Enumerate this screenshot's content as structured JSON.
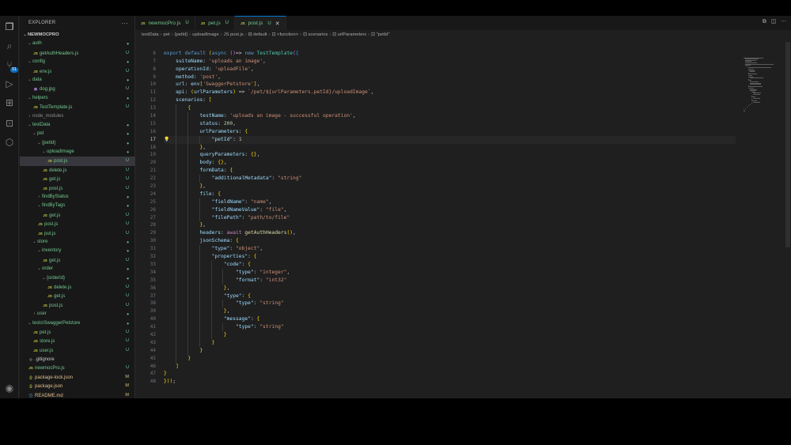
{
  "explorer": {
    "title": "EXPLORER",
    "more": "···",
    "root": "NEWMOCPRO"
  },
  "tree": [
    {
      "depth": 1,
      "kind": "folder",
      "open": true,
      "name": "auth",
      "badge": "dot",
      "tone": "u"
    },
    {
      "depth": 2,
      "kind": "js",
      "name": "getAuthHeaders.js",
      "badge": "U",
      "tone": "u"
    },
    {
      "depth": 1,
      "kind": "folder",
      "open": true,
      "name": "config",
      "badge": "dot",
      "tone": "u"
    },
    {
      "depth": 2,
      "kind": "js",
      "name": "env.js",
      "badge": "U",
      "tone": "u"
    },
    {
      "depth": 1,
      "kind": "folder",
      "open": true,
      "name": "data",
      "badge": "dot",
      "tone": "u"
    },
    {
      "depth": 2,
      "kind": "img",
      "name": "dog.jpg",
      "badge": "U",
      "tone": "u"
    },
    {
      "depth": 1,
      "kind": "folder",
      "open": true,
      "name": "helpers",
      "badge": "dot",
      "tone": "u"
    },
    {
      "depth": 2,
      "kind": "js",
      "name": "TestTemplate.js",
      "badge": "U",
      "tone": "u"
    },
    {
      "depth": 1,
      "kind": "folder",
      "open": false,
      "name": "node_modules",
      "badge": "",
      "tone": "muted"
    },
    {
      "depth": 1,
      "kind": "folder",
      "open": true,
      "name": "testData",
      "badge": "dot",
      "tone": "u"
    },
    {
      "depth": 2,
      "kind": "folder",
      "open": true,
      "name": "pet",
      "badge": "dot",
      "tone": "u"
    },
    {
      "depth": 3,
      "kind": "folder",
      "open": true,
      "name": "{petId}",
      "badge": "dot",
      "tone": "u"
    },
    {
      "depth": 4,
      "kind": "folder",
      "open": true,
      "name": "uploadImage",
      "badge": "dot",
      "tone": "u"
    },
    {
      "depth": 5,
      "kind": "js",
      "name": "post.js",
      "badge": "U",
      "tone": "u",
      "selected": true
    },
    {
      "depth": 4,
      "kind": "js",
      "name": "delete.js",
      "badge": "U",
      "tone": "u"
    },
    {
      "depth": 4,
      "kind": "js",
      "name": "get.js",
      "badge": "U",
      "tone": "u"
    },
    {
      "depth": 4,
      "kind": "js",
      "name": "post.js",
      "badge": "U",
      "tone": "u"
    },
    {
      "depth": 3,
      "kind": "folder",
      "open": false,
      "name": "findByStatus",
      "badge": "dot",
      "tone": "u"
    },
    {
      "depth": 3,
      "kind": "folder",
      "open": true,
      "name": "findByTags",
      "badge": "dot",
      "tone": "u"
    },
    {
      "depth": 4,
      "kind": "js",
      "name": "get.js",
      "badge": "U",
      "tone": "u"
    },
    {
      "depth": 3,
      "kind": "js",
      "name": "post.js",
      "badge": "U",
      "tone": "u"
    },
    {
      "depth": 3,
      "kind": "js",
      "name": "put.js",
      "badge": "U",
      "tone": "u"
    },
    {
      "depth": 2,
      "kind": "folder",
      "open": true,
      "name": "store",
      "badge": "dot",
      "tone": "u"
    },
    {
      "depth": 3,
      "kind": "folder",
      "open": true,
      "name": "inventory",
      "badge": "dot",
      "tone": "u"
    },
    {
      "depth": 4,
      "kind": "js",
      "name": "get.js",
      "badge": "U",
      "tone": "u"
    },
    {
      "depth": 3,
      "kind": "folder",
      "open": true,
      "name": "order",
      "badge": "dot",
      "tone": "u"
    },
    {
      "depth": 4,
      "kind": "folder",
      "open": true,
      "name": "{orderId}",
      "badge": "dot",
      "tone": "u"
    },
    {
      "depth": 5,
      "kind": "js",
      "name": "delete.js",
      "badge": "U",
      "tone": "u"
    },
    {
      "depth": 5,
      "kind": "js",
      "name": "get.js",
      "badge": "U",
      "tone": "u"
    },
    {
      "depth": 4,
      "kind": "js",
      "name": "post.js",
      "badge": "U",
      "tone": "u"
    },
    {
      "depth": 2,
      "kind": "folder",
      "open": false,
      "name": "user",
      "badge": "dot",
      "tone": "u"
    },
    {
      "depth": 1,
      "kind": "folder",
      "open": true,
      "name": "tests\\SwaggerPetstore",
      "badge": "dot",
      "tone": "u"
    },
    {
      "depth": 2,
      "kind": "js",
      "name": "pet.js",
      "badge": "U",
      "tone": "u"
    },
    {
      "depth": 2,
      "kind": "js",
      "name": "store.js",
      "badge": "U",
      "tone": "u"
    },
    {
      "depth": 2,
      "kind": "js",
      "name": "user.js",
      "badge": "U",
      "tone": "u"
    },
    {
      "depth": 1,
      "kind": "dot",
      "name": ".gitignore",
      "badge": "",
      "tone": "plain"
    },
    {
      "depth": 1,
      "kind": "js",
      "name": "newmocPro.js",
      "badge": "U",
      "tone": "u"
    },
    {
      "depth": 1,
      "kind": "json",
      "name": "package-lock.json",
      "badge": "M",
      "tone": "m"
    },
    {
      "depth": 1,
      "kind": "json",
      "name": "package.json",
      "badge": "M",
      "tone": "m"
    },
    {
      "depth": 1,
      "kind": "md",
      "name": "README.md",
      "badge": "M",
      "tone": "m"
    }
  ],
  "tabs": [
    {
      "icon": "JS",
      "name": "newmocPro.js",
      "badge": "U",
      "active": false,
      "close": ""
    },
    {
      "icon": "JS",
      "name": "pet.js",
      "badge": "U",
      "active": false,
      "close": ""
    },
    {
      "icon": "JS",
      "name": "post.js",
      "badge": "U",
      "active": true,
      "close": "✕"
    }
  ],
  "breadcrumbs": [
    "testData",
    "pet",
    "{petId}",
    "uploadImage",
    "JS post.js",
    "⊟ default",
    "⊡ <function>",
    "⊡ scenarios",
    "⊡ urlParameters",
    "⊡ \"petId\""
  ],
  "editor": {
    "first_line": 6,
    "current_line": 17,
    "lightbulb_line": 17,
    "lines": [
      "",
      "export default (async ()=> new TestTemplate({",
      "    suiteName: 'uploads an image',",
      "    operationId: 'uploadFile',",
      "    method: 'post',",
      "    url: env['SwaggerPetstore'],",
      "    api: (urlParameters) => `/pet/${urlParameters.petId}/uploadImage`,",
      "    scenarios: [",
      "        {",
      "            testName: 'uploads an image - successful operation',",
      "            status: 200,",
      "            urlParameters: {",
      "                \"petId\": 1",
      "            },",
      "            queryParameters: {},",
      "            body: {},",
      "            formData: {",
      "                \"additionalMetadata\": \"string\"",
      "            },",
      "            file: {",
      "                \"fieldName\": \"name\",",
      "                \"fieldNameValue\": \"file\",",
      "                \"filePath\": \"path/to/file\"",
      "            },",
      "            headers: await getAuthHeaders(),",
      "            jsonSchema: {",
      "                \"type\": \"object\",",
      "                \"properties\": {",
      "                    \"code\": {",
      "                        \"type\": \"integer\",",
      "                        \"format\": \"int32\"",
      "                    },",
      "                    \"type\": {",
      "                        \"type\": \"string\"",
      "                    },",
      "                    \"message\": {",
      "                        \"type\": \"string\"",
      "                    }",
      "                }",
      "            }",
      "        }",
      "    ]",
      "}",
      "}));"
    ]
  },
  "colors": {
    "accent": "#0078d4",
    "untracked": "#73c991",
    "modified": "#e2c08d",
    "js_icon": "#cbcb41"
  }
}
